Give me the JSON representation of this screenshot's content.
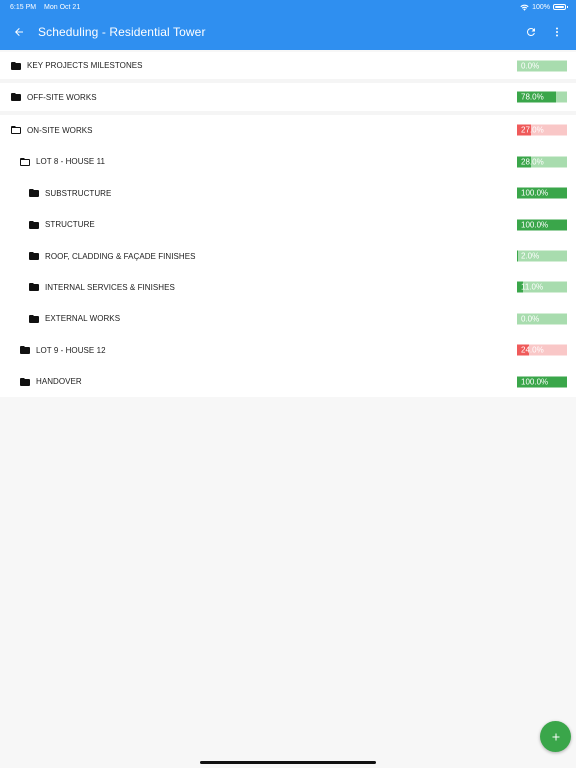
{
  "status_bar": {
    "time": "6:15 PM",
    "date": "Mon Oct 21",
    "battery": "100%"
  },
  "app_bar": {
    "title": "Scheduling - Residential Tower",
    "back_icon": "arrow-left-icon",
    "refresh_icon": "refresh-icon",
    "menu_icon": "more-vertical-icon",
    "color": "#2f8ff0"
  },
  "colors": {
    "progress_green": "#3aa64a",
    "progress_green_track": "#a8dcae",
    "progress_red": "#ef5a5a",
    "progress_red_track": "#f9c7c7"
  },
  "tree_items": [
    {
      "label": "KEY PROJECTS MILESTONES",
      "level": 0,
      "folder": "closed",
      "progress_text": "0.0%",
      "progress": 0.0,
      "status": "green",
      "sep": true
    },
    {
      "label": "OFF-SITE WORKS",
      "level": 0,
      "folder": "closed",
      "progress_text": "78.0%",
      "progress": 78.0,
      "status": "green",
      "sep": true
    },
    {
      "label": "ON-SITE WORKS",
      "level": 0,
      "folder": "open",
      "progress_text": "27.0%",
      "progress": 27.0,
      "status": "red",
      "sep": false
    },
    {
      "label": "LOT 8 - HOUSE 11",
      "level": 1,
      "folder": "open",
      "progress_text": "28.0%",
      "progress": 28.0,
      "status": "green",
      "sep": false
    },
    {
      "label": "SUBSTRUCTURE",
      "level": 2,
      "folder": "closed",
      "progress_text": "100.0%",
      "progress": 100.0,
      "status": "green",
      "sep": false
    },
    {
      "label": "STRUCTURE",
      "level": 2,
      "folder": "closed",
      "progress_text": "100.0%",
      "progress": 100.0,
      "status": "green",
      "sep": false
    },
    {
      "label": "ROOF, CLADDING & FAÇADE FINISHES",
      "level": 2,
      "folder": "closed",
      "progress_text": "2.0%",
      "progress": 2.0,
      "status": "green",
      "sep": false
    },
    {
      "label": "INTERNAL SERVICES & FINISHES",
      "level": 2,
      "folder": "closed",
      "progress_text": "11.0%",
      "progress": 11.0,
      "status": "green",
      "sep": false
    },
    {
      "label": "EXTERNAL WORKS",
      "level": 2,
      "folder": "closed",
      "progress_text": "0.0%",
      "progress": 0.0,
      "status": "green",
      "sep": false
    },
    {
      "label": "LOT 9 - HOUSE 12",
      "level": 1,
      "folder": "closed",
      "progress_text": "24.0%",
      "progress": 24.0,
      "status": "red",
      "sep": false
    },
    {
      "label": "HANDOVER",
      "level": 1,
      "folder": "closed",
      "progress_text": "100.0%",
      "progress": 100.0,
      "status": "green",
      "sep": false
    }
  ],
  "fab": {
    "icon": "plus-icon"
  }
}
